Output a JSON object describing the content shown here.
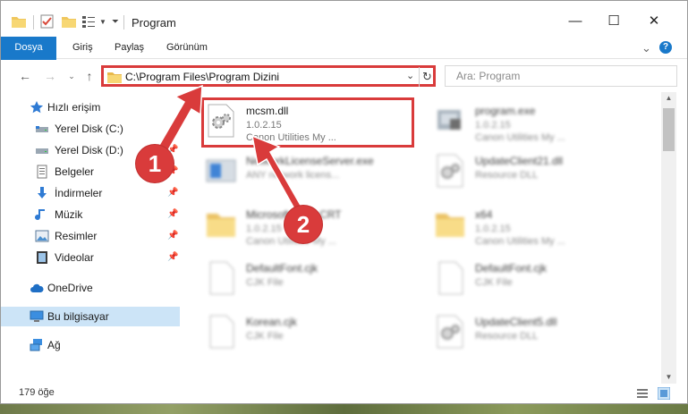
{
  "window": {
    "title": "Program",
    "controls": {
      "minimize": "—",
      "maximize": "☐",
      "close": "✕"
    }
  },
  "ribbon": {
    "tabs": [
      {
        "label": "Dosya",
        "active": true
      },
      {
        "label": "Giriş"
      },
      {
        "label": "Paylaş"
      },
      {
        "label": "Görünüm"
      }
    ],
    "collapse_glyph": "⌄",
    "help_glyph": "?"
  },
  "address_bar": {
    "path": "C:\\Program Files\\Program Dizini",
    "dropdown_glyph": "⌄",
    "refresh_glyph": "↻"
  },
  "search": {
    "placeholder": "Ara: Program"
  },
  "sidebar": {
    "items": [
      {
        "label": "Hızlı erişim",
        "icon": "star-icon",
        "pinned": false
      },
      {
        "label": "Yerel Disk (C:)",
        "icon": "drive-icon",
        "pinned": true
      },
      {
        "label": "Yerel Disk (D:)",
        "icon": "drive-icon",
        "pinned": true
      },
      {
        "label": "Belgeler",
        "icon": "documents-icon",
        "pinned": true
      },
      {
        "label": "İndirmeler",
        "icon": "download-icon",
        "pinned": true
      },
      {
        "label": "Müzik",
        "icon": "music-icon",
        "pinned": true
      },
      {
        "label": "Resimler",
        "icon": "pictures-icon",
        "pinned": true
      },
      {
        "label": "Videolar",
        "icon": "video-icon",
        "pinned": true
      },
      {
        "label": "OneDrive",
        "icon": "cloud-icon",
        "pinned": false
      },
      {
        "label": "Bu bilgisayar",
        "icon": "computer-icon",
        "pinned": false,
        "selected": true
      },
      {
        "label": "Ağ",
        "icon": "network-icon",
        "pinned": false
      }
    ]
  },
  "files": [
    {
      "name": "mcsm.dll",
      "line2": "1.0.2.15",
      "line3": "Canon Utilities My ...",
      "icon": "dll-gear-icon",
      "highlighted": true
    },
    {
      "name": "program.exe",
      "line2": "1.0.2.15",
      "line3": "Canon Utilities My ...",
      "icon": "exe-icon"
    },
    {
      "name": "NetworkLicenseServer.exe",
      "line2": "ANY network licens...",
      "line3": "",
      "icon": "exe-blue-icon"
    },
    {
      "name": "UpdateClient21.dll",
      "line2": "Resource DLL",
      "line3": "",
      "icon": "dll-gear-icon"
    },
    {
      "name": "Microsoft ... 80 CRT",
      "line2": "1.0.2.15",
      "line3": "Canon Utilities My ...",
      "icon": "folder-icon"
    },
    {
      "name": "x64",
      "line2": "1.0.2.15",
      "line3": "Canon Utilities My ...",
      "icon": "folder-icon"
    },
    {
      "name": "DefaultFont.cjk",
      "line2": "CJK File",
      "line3": "",
      "icon": "blank-file-icon"
    },
    {
      "name": "DefaultFont.cjk",
      "line2": "CJK File",
      "line3": "",
      "icon": "blank-file-icon"
    },
    {
      "name": "Korean.cjk",
      "line2": "CJK File",
      "line3": "",
      "icon": "blank-file-icon"
    },
    {
      "name": "UpdateClient5.dll",
      "line2": "Resource DLL",
      "line3": "",
      "icon": "dll-gear-icon"
    }
  ],
  "status": {
    "item_count": "179 öğe"
  },
  "annotations": {
    "step1": "1",
    "step2": "2"
  },
  "colors": {
    "accent": "#1979ca",
    "annotation": "#d93b3b",
    "selected_bg": "#cce4f7"
  }
}
